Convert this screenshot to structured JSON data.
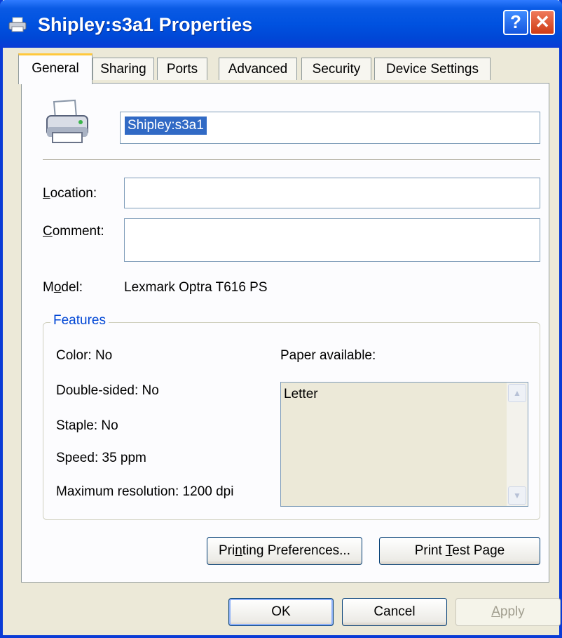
{
  "window": {
    "title": "Shipley:s3a1 Properties",
    "help_glyph": "?",
    "close_glyph": "✕"
  },
  "tabs": [
    {
      "label": "General",
      "active": true
    },
    {
      "label": "Sharing"
    },
    {
      "label": "Ports"
    },
    {
      "label": "Advanced"
    },
    {
      "label": "Security"
    },
    {
      "label": "Device Settings"
    }
  ],
  "general": {
    "printer_name": "Shipley:s3a1",
    "location_label": "Location:",
    "location_accel": "L",
    "location_rest": "ocation:",
    "location_value": "",
    "comment_accel": "C",
    "comment_rest": "omment:",
    "comment_value": "",
    "model_label_pre": "M",
    "model_label_accel": "o",
    "model_label_post": "del:",
    "model_value": "Lexmark Optra T616 PS",
    "features": {
      "legend": "Features",
      "color": "Color: No",
      "double_sided": "Double-sided: No",
      "staple": "Staple: No",
      "speed": "Speed: 35 ppm",
      "max_resolution": "Maximum resolution: 1200 dpi",
      "paper_label": "Paper available:",
      "paper_items": [
        "Letter"
      ]
    },
    "printing_prefs_pre": "Pri",
    "printing_prefs_accel": "n",
    "printing_prefs_post": "ting Preferences...",
    "print_test_pre": "Print ",
    "print_test_accel": "T",
    "print_test_post": "est Page"
  },
  "footer": {
    "ok": "OK",
    "cancel": "Cancel",
    "apply_accel": "A",
    "apply_rest": "pply"
  },
  "colors": {
    "titlebar": "#0052e0",
    "face": "#ece9d8",
    "accent_tab": "#ffc83c",
    "legend": "#0046d5"
  }
}
